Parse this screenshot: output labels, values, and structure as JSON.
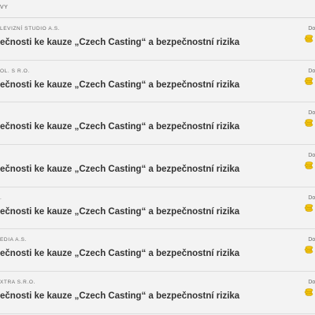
{
  "header": {
    "title_fragment": "VY"
  },
  "messages": [
    {
      "sender": "LEVIZNÍ STUDIO A.S.",
      "subject": "ečnosti ke kauze „Czech Casting“ a bezpečnostní rizika",
      "status": "Doruč",
      "icon": "coins-icon"
    },
    {
      "sender": "OL. S R.O.",
      "subject": "ečnosti ke kauze „Czech Casting“ a bezpečnostní rizika",
      "status": "Doruč",
      "icon": "coins-icon"
    },
    {
      "sender": "",
      "subject": "ečnosti ke kauze „Czech Casting“ a bezpečnostní rizika",
      "status": "Doruč",
      "icon": "coins-icon"
    },
    {
      "sender": "",
      "subject": "ečnosti ke kauze „Czech Casting“ a bezpečnostní rizika",
      "status": "Doruč",
      "icon": "coins-icon"
    },
    {
      "sender": ".",
      "subject": "ečnosti ke kauze „Czech Casting“ a bezpečnostní rizika",
      "status": "Doruč",
      "icon": "coins-icon"
    },
    {
      "sender": "EDIA A.S.",
      "subject": "ečnosti ke kauze „Czech Casting“ a bezpečnostní rizika",
      "status": "Doruč",
      "icon": "coins-icon"
    },
    {
      "sender": "XTRA S.R.O.",
      "subject": "ečnosti ke kauze „Czech Casting“ a bezpečnostní rizika",
      "status": "Doruč",
      "icon": "coins-icon"
    }
  ],
  "colors": {
    "background": "#f3f3f3",
    "divider": "#dcdcdc",
    "subject_text": "#333333",
    "meta_text": "#6a6a6a",
    "coin_fill": "#f2c40f",
    "coin_edge": "#c99a00"
  }
}
